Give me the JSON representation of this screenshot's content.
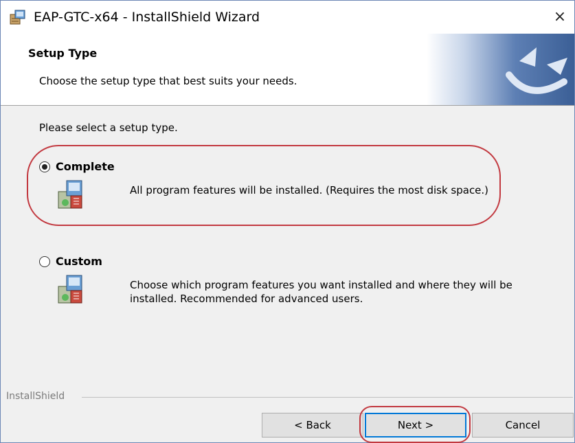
{
  "window": {
    "title": "EAP-GTC-x64 - InstallShield Wizard",
    "close_glyph": "×"
  },
  "header": {
    "title": "Setup Type",
    "subtitle": "Choose the setup type that best suits your needs."
  },
  "body": {
    "prompt": "Please select a setup type.",
    "options": [
      {
        "label": "Complete",
        "description": "All program features will be installed. (Requires the most disk space.)",
        "selected": true
      },
      {
        "label": "Custom",
        "description": "Choose which program features you want installed and where they will be installed. Recommended for advanced users.",
        "selected": false
      }
    ]
  },
  "footer": {
    "brand": "InstallShield",
    "back_label": "< Back",
    "next_label": "Next >",
    "cancel_label": "Cancel"
  },
  "icons": {
    "app": "installer-box-icon",
    "header": "installshield-swirl-logo",
    "option": "setup-package-icon",
    "close": "close-icon"
  },
  "colors": {
    "annotation_red": "#c2383f",
    "focus_blue": "#0078d7",
    "header_graphic": "#3b5f96"
  }
}
